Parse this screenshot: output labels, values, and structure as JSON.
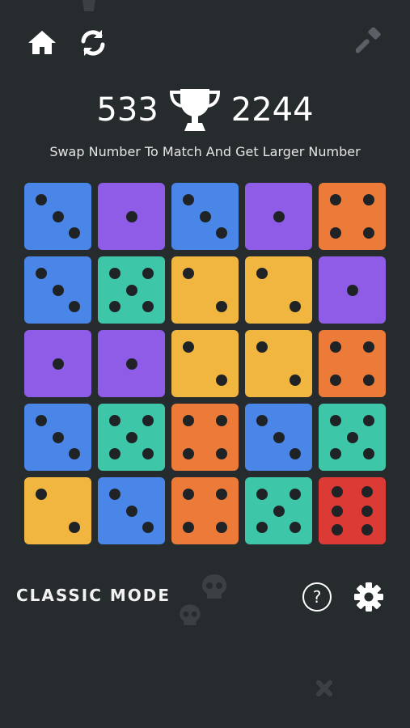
{
  "icons": {
    "home": "home-icon",
    "restart": "restart-icon",
    "hammer": "hammer-icon",
    "trophy": "trophy-icon",
    "help": "help-icon",
    "settings": "gear-icon"
  },
  "score": {
    "current": "533",
    "best": "2244"
  },
  "subtitle": "Swap Number To Match And Get Larger Number",
  "mode_label": "CLASSIC MODE",
  "help_label": "?",
  "colors": {
    "background": "#262b2e",
    "blue": "#4a86e8",
    "purple": "#8e5ce6",
    "orange": "#ec7a38",
    "teal": "#3ec6a8",
    "yellow": "#f0b63f",
    "red": "#dc3b35"
  },
  "board": [
    [
      3,
      1,
      3,
      1,
      4
    ],
    [
      3,
      5,
      2,
      2,
      1
    ],
    [
      1,
      1,
      2,
      2,
      4
    ],
    [
      3,
      5,
      4,
      3,
      5
    ],
    [
      2,
      3,
      4,
      5,
      6
    ]
  ]
}
